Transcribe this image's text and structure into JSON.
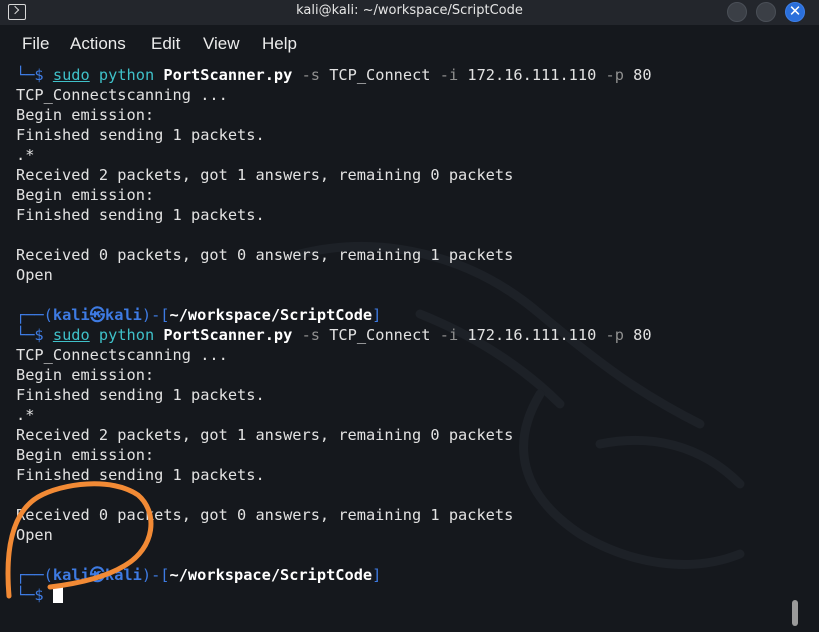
{
  "window": {
    "title": "kali@kali: ~/workspace/ScriptCode",
    "icons": {
      "app": "terminal-icon",
      "minimize": "minimize-icon",
      "maximize": "maximize-icon",
      "close": "close-icon",
      "close_glyph": "✕"
    }
  },
  "menu": {
    "file": "File",
    "actions": "Actions",
    "edit": "Edit",
    "view": "View",
    "help": "Help"
  },
  "terminal": {
    "prompt": {
      "corner_top": "┌──",
      "corner_bottom": "└─",
      "dollar": "$",
      "paren_open": "(",
      "paren_close": ")",
      "user": "kali",
      "at_symbol": "㉿",
      "host": "kali",
      "dash": "-",
      "bracket_open": "[",
      "bracket_close": "]",
      "path": "~/workspace/ScriptCode"
    },
    "command": {
      "sudo": "sudo",
      "python": "python",
      "script": "PortScanner.py",
      "flag_s": "-s",
      "scan_type": "TCP_Connect",
      "flag_i": "-i",
      "ip": "172.16.111.110",
      "flag_p": "-p",
      "port": "80"
    },
    "output": {
      "scanning": "TCP_Connectscanning ...",
      "begin": "Begin emission:",
      "finished": "Finished sending 1 packets.",
      "dot_star": ".*",
      "received_2": "Received 2 packets, got 1 answers, remaining 0 packets",
      "received_0": "Received 0 packets, got 0 answers, remaining 1 packets",
      "open": "Open"
    }
  },
  "colors": {
    "background": "#15181d",
    "prompt_blue": "#3e7be3",
    "command_cyan": "#3fc1c9",
    "annotation_orange": "#f28a35",
    "close_button_blue": "#2a6fdb"
  }
}
